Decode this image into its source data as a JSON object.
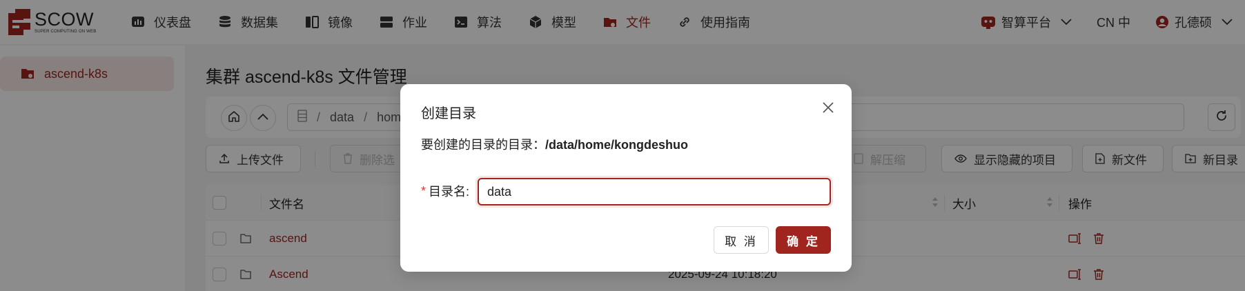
{
  "header": {
    "logo": {
      "title": "SCOW",
      "subtitle": "SUPER COMPUTING ON WEB"
    },
    "nav": [
      {
        "label": "仪表盘",
        "icon": "dashboard-icon"
      },
      {
        "label": "数据集",
        "icon": "database-icon"
      },
      {
        "label": "镜像",
        "icon": "image-icon"
      },
      {
        "label": "作业",
        "icon": "job-icon"
      },
      {
        "label": "算法",
        "icon": "algorithm-icon"
      },
      {
        "label": "模型",
        "icon": "model-icon"
      },
      {
        "label": "文件",
        "icon": "folder-icon",
        "active": true
      },
      {
        "label": "使用指南",
        "icon": "link-icon"
      }
    ],
    "platform": "智算平台",
    "language": "CN 中",
    "user": "孔德硕"
  },
  "sidebar": {
    "items": [
      {
        "label": "ascend-k8s"
      }
    ]
  },
  "main": {
    "title": "集群 ascend-k8s 文件管理",
    "path": {
      "root_icon": "server-icon",
      "segments": [
        "data",
        "hom"
      ]
    },
    "toolbar": {
      "upload": "上传文件",
      "delete": "删除选",
      "decompress": "解压缩",
      "show_hidden": "显示隐藏的项目",
      "new_file": "新文件",
      "new_dir": "新目录"
    },
    "table": {
      "headers": {
        "name": "文件名",
        "size": "大小",
        "actions": "操作"
      },
      "rows": [
        {
          "name": "ascend",
          "modified": ""
        },
        {
          "name": "Ascend",
          "modified": "2025-09-24 10:18:20"
        }
      ]
    }
  },
  "modal": {
    "title": "创建目录",
    "desc_prefix": "要创建的目录的目录：",
    "desc_path": "/data/home/kongdeshuo",
    "field_label": "目录名:",
    "field_value": "data",
    "cancel": "取 消",
    "ok": "确 定"
  },
  "colors": {
    "accent": "#a1251f",
    "overlay": "rgba(0,0,0,0.45)"
  }
}
